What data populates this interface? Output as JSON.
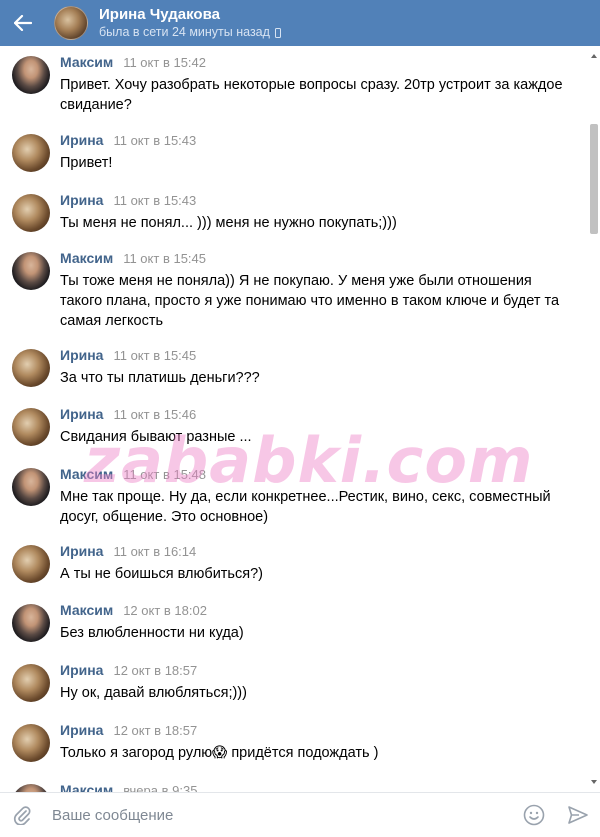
{
  "header": {
    "name": "Ирина Чудакова",
    "status": "была в сети 24 минуты назад"
  },
  "messages": [
    {
      "author": "Максим",
      "time": "11 окт в 15:42",
      "text": "Привет. Хочу разобрать некоторые вопросы сразу. 20тр устроит за каждое свидание?",
      "avatar": "maxim"
    },
    {
      "author": "Ирина",
      "time": "11 окт в 15:43",
      "text": "Привет!",
      "avatar": "irina"
    },
    {
      "author": "Ирина",
      "time": "11 окт в 15:43",
      "text": "Ты меня не понял... ))) меня не нужно покупать;)))",
      "avatar": "irina"
    },
    {
      "author": "Максим",
      "time": "11 окт в 15:45",
      "text": "Ты тоже меня не поняла)) Я не покупаю. У меня уже были отношения такого плана, просто я уже понимаю что именно в таком ключе и будет та самая легкость",
      "avatar": "maxim"
    },
    {
      "author": "Ирина",
      "time": "11 окт в 15:45",
      "text": "За что ты платишь деньги???",
      "avatar": "irina"
    },
    {
      "author": "Ирина",
      "time": "11 окт в 15:46",
      "text": "Свидания бывают разные ...",
      "avatar": "irina"
    },
    {
      "author": "Максим",
      "time": "11 окт в 15:48",
      "text": "Мне так проще. Ну да, если конкретнее...Рестик, вино, секс, совместный досуг, общение. Это основное)",
      "avatar": "maxim"
    },
    {
      "author": "Ирина",
      "time": "11 окт в 16:14",
      "text": "А ты не боишься влюбиться?)",
      "avatar": "irina"
    },
    {
      "author": "Максим",
      "time": "12 окт в 18:02",
      "text": "Без влюбленности ни куда)",
      "avatar": "maxim"
    },
    {
      "author": "Ирина",
      "time": "12 окт в 18:57",
      "text": "Ну ок, давай влюбляться;)))",
      "avatar": "irina"
    },
    {
      "author": "Ирина",
      "time": "12 окт в 18:57",
      "text": "Только я загород рулю😱 придётся подождать )",
      "avatar": "irina"
    },
    {
      "author": "Максим",
      "time": "вчера в 9:35",
      "text": "",
      "avatar": "maxim"
    }
  ],
  "watermark": "zababki.com",
  "composer": {
    "placeholder": "Ваше сообщение"
  },
  "colors": {
    "header_bg": "#5181b8",
    "author": "#42648b",
    "time": "#939393"
  },
  "icons": [
    "back-arrow-icon",
    "phone-icon",
    "paperclip-icon",
    "smile-icon",
    "send-icon"
  ]
}
